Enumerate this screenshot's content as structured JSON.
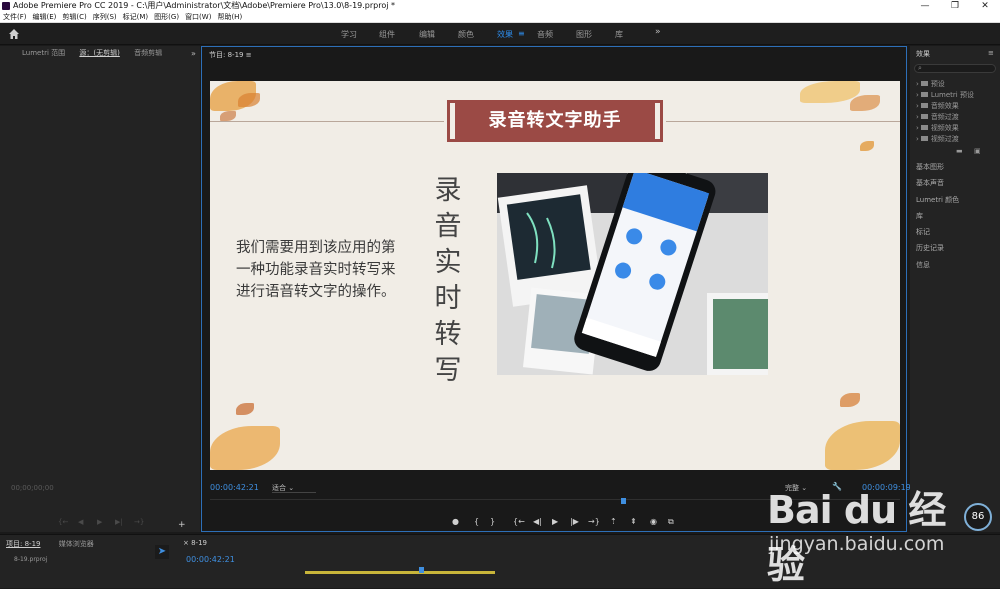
{
  "window": {
    "title": "Adobe Premiere Pro CC 2019 - C:\\用户\\Administrator\\文档\\Adobe\\Premiere Pro\\13.0\\8-19.prproj *",
    "controls": {
      "minimize": "—",
      "maximize": "❐",
      "close": "✕"
    }
  },
  "menu": [
    "文件(F)",
    "编辑(E)",
    "剪辑(C)",
    "序列(S)",
    "标记(M)",
    "图形(G)",
    "窗口(W)",
    "帮助(H)"
  ],
  "workspaces": {
    "tabs": [
      "学习",
      "组件",
      "编辑",
      "颜色",
      "效果",
      "音频",
      "图形",
      "库"
    ],
    "active": "效果",
    "more": "»"
  },
  "source_panel": {
    "tabs": [
      "Lumetri 范围",
      "源：(无剪辑)",
      "音频剪辑"
    ],
    "active_tab": "源：(无剪辑)",
    "more": "»",
    "timecode": "00;00;00;00"
  },
  "program_monitor": {
    "header": "节目: 8-19",
    "menu_glyph": "≡",
    "timecode": "00:00:42:21",
    "fit": "适合",
    "quality": "完整",
    "duration": "00:00:09:19"
  },
  "slide": {
    "title": "录音转文字助手",
    "body": "我们需要用到该应用的第一种功能录音实时转写来进行语音转文字的操作。",
    "vertical_text": [
      "录",
      "音",
      "实",
      "时",
      "转",
      "写"
    ]
  },
  "effects_panel": {
    "title": "效果",
    "menu_glyph": "≡",
    "tree": [
      "预设",
      "Lumetri 预设",
      "音频效果",
      "音频过渡",
      "视频效果",
      "视频过渡"
    ],
    "panels": [
      "基本图形",
      "基本声音",
      "Lumetri 颜色",
      "库",
      "标记",
      "历史记录",
      "信息"
    ]
  },
  "project_panel": {
    "tabs": [
      "项目: 8-19",
      "媒体浏览器"
    ],
    "file": "8-19.prproj"
  },
  "timeline": {
    "tab": "8-19",
    "timecode": "00:00:42:21"
  },
  "watermark": {
    "brand": "Bai du 经验",
    "url": "jingyan.baidu.com"
  },
  "badge": "86"
}
